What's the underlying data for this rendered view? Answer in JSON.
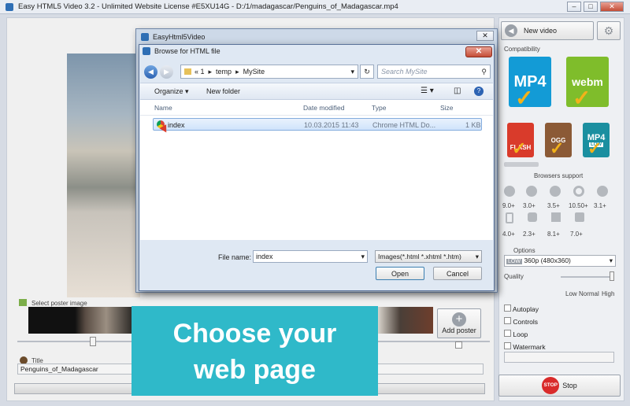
{
  "main_window": {
    "title": "Easy HTML5 Video 3.2  -  Unlimited Website License #E5XU14G  -  D:/1/madagascar/Penguins_of_Madagascar.mp4",
    "min": "–",
    "max": "□",
    "close": "✕"
  },
  "poster": {
    "label": "Select poster image",
    "add_label": "Add poster"
  },
  "title_section": {
    "label": "Title",
    "value": "Penguins_of_Madagascar"
  },
  "side": {
    "new_video": "New video",
    "compat_label": "Compatibility",
    "formats": [
      "MP4",
      "webm",
      "FLASH",
      "OGG",
      "MP4"
    ],
    "format_sub": [
      "",
      "",
      "",
      "",
      "LOW"
    ],
    "browsers_label": "Browsers support",
    "browser_versions_row1": [
      "9.0+",
      "3.0+",
      "3.5+",
      "10.50+",
      "3.1+"
    ],
    "browser_versions_row2": [
      "4.0+",
      "2.3+",
      "8.1+",
      "7.0+"
    ],
    "options_label": "Options",
    "quality_badge": "LOW",
    "quality_value": "360p (480x360)",
    "quality_label": "Quality",
    "slider_labels": [
      "Low",
      "Normal",
      "High"
    ],
    "checkboxes": [
      "Autoplay",
      "Controls",
      "Loop",
      "Watermark"
    ],
    "stop_badge": "STOP",
    "stop_label": "Stop"
  },
  "outer_dialog": {
    "title": "EasyHtml5Video",
    "close": "✕"
  },
  "dialog": {
    "title": "Browse for HTML file",
    "close": "✕",
    "breadcrumb": [
      "« 1",
      "temp",
      "MySite"
    ],
    "search_placeholder": "Search MySite",
    "organize": "Organize ▾",
    "new_folder": "New folder",
    "columns": [
      "Name",
      "Date modified",
      "Type",
      "Size"
    ],
    "files": [
      {
        "name": "index",
        "date": "10.03.2015 11:43",
        "type": "Chrome HTML Do...",
        "size": "1 KB"
      }
    ],
    "file_name_label": "File name:",
    "file_name_value": "index",
    "filter_value": "Images(*.html *.xhtml *.htm)",
    "open_label": "Open",
    "cancel_label": "Cancel"
  },
  "banner": {
    "line1": "Choose your",
    "line2": "web page"
  },
  "colors": {
    "banner": "#2fb9c9",
    "mp4": "#139bd6",
    "webm": "#7fbd2b",
    "flash": "#d93b2b",
    "ogg": "#8b5a36",
    "mp4low": "#1b8fa0"
  }
}
